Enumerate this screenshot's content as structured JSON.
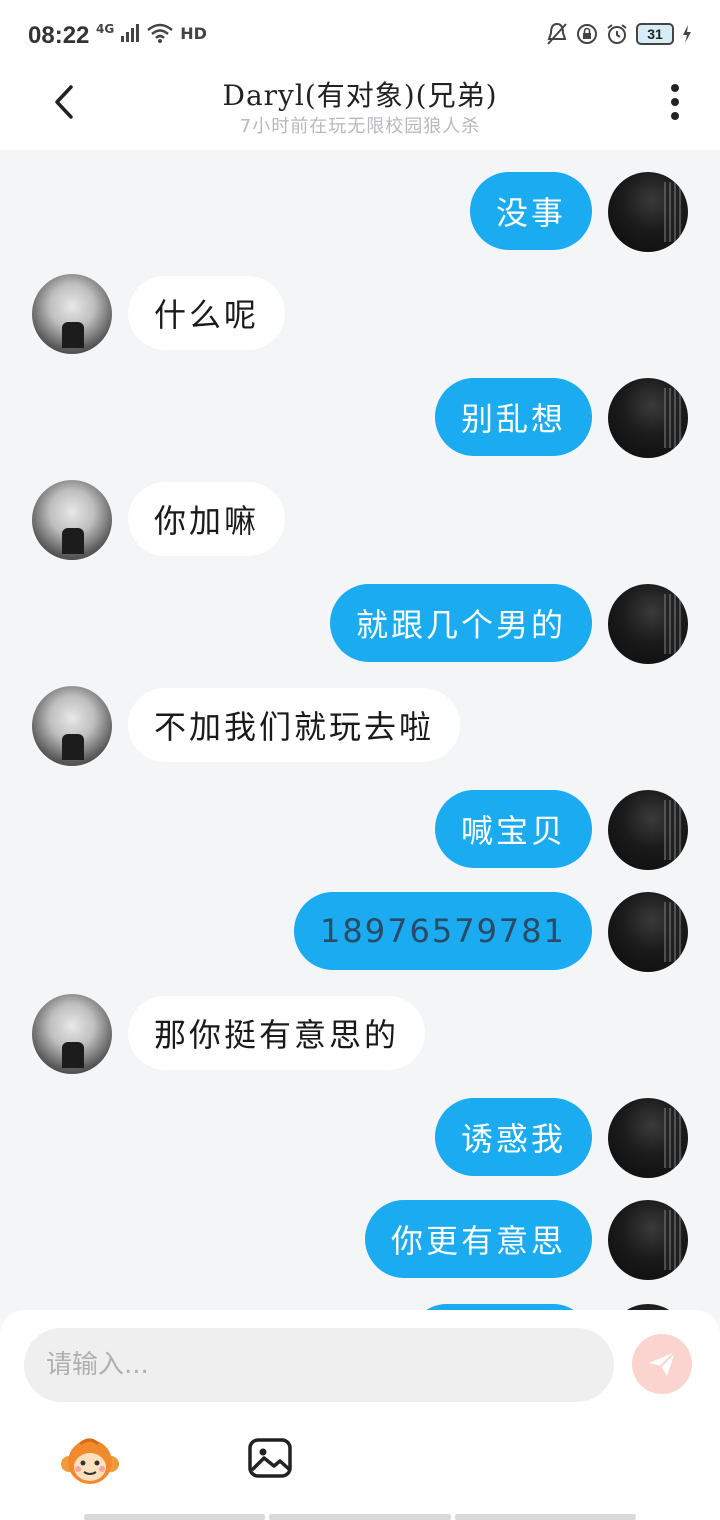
{
  "status_bar": {
    "time": "08:22",
    "network": "4G",
    "wifi_label": "HD",
    "battery": "31"
  },
  "header": {
    "title": "Daryl(有对象)(兄弟)",
    "subtitle": "7小时前在玩无限校园狼人杀"
  },
  "messages": [
    {
      "side": "out",
      "text": "没事"
    },
    {
      "side": "in",
      "text": "什么呢"
    },
    {
      "side": "out",
      "text": "别乱想"
    },
    {
      "side": "in",
      "text": "你加嘛"
    },
    {
      "side": "out",
      "text": "就跟几个男的"
    },
    {
      "side": "in",
      "text": "不加我们就玩去啦"
    },
    {
      "side": "out",
      "text": "喊宝贝"
    },
    {
      "side": "out",
      "text": "18976579781"
    },
    {
      "side": "in",
      "text": "那你挺有意思的"
    },
    {
      "side": "out",
      "text": "诱惑我"
    },
    {
      "side": "out",
      "text": "你更有意思"
    }
  ],
  "input": {
    "placeholder": "请输入..."
  },
  "colors": {
    "outgoing_bubble": "#1aabf0",
    "incoming_bubble": "#ffffff",
    "send_button": "#fbd3cf",
    "background": "#f3f5f7"
  },
  "icons": {
    "back": "chevron-left-icon",
    "more": "vertical-dots-icon",
    "send": "paper-plane-icon",
    "emoji": "monkey-emoji-icon",
    "image": "image-icon"
  }
}
